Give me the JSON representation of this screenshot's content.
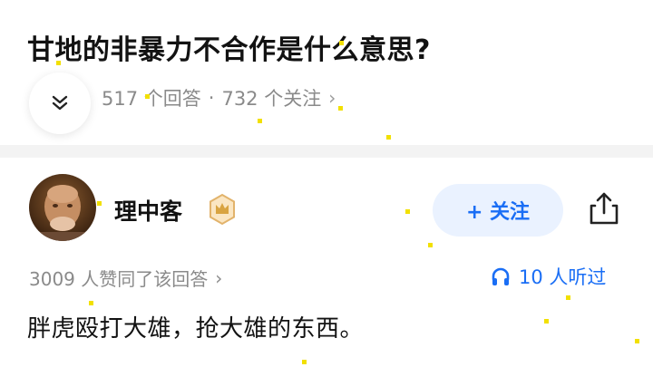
{
  "question": {
    "title": "甘地的非暴力不合作是什么意思?",
    "answers_count": "517 个回答",
    "separator": "·",
    "followers_count": "732 个关注",
    "meta_chevron": "›"
  },
  "author": {
    "name": "理中客",
    "follow_label": "+ 关注"
  },
  "answer": {
    "likes_text": "3009 人赞同了该回答",
    "likes_chevron": "›",
    "listen_text": "10 人听过",
    "excerpt": "胖虎殴打大雄，抢大雄的东西。"
  },
  "colors": {
    "accent": "#1a6ef5",
    "follow_bg": "#eaf2ff",
    "muted_text": "#8a8a8a",
    "badge_gold": "#d9a441"
  },
  "icons": [
    "chevron-down-icon",
    "crown-badge-icon",
    "share-icon",
    "headphones-icon"
  ]
}
